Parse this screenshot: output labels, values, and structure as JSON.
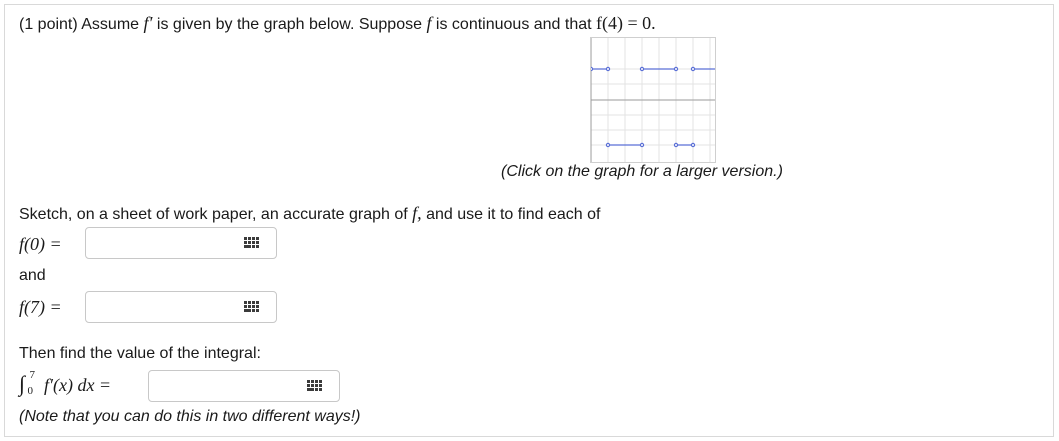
{
  "problem": {
    "intro_prefix": "(1 point) Assume",
    "intro_fprime": "f′",
    "intro_mid": "is given by the graph below. Suppose",
    "intro_f": "f",
    "intro_tail": "is continuous and that",
    "intro_condition": "f(4) = 0.",
    "graph_caption": "(Click on the graph for a larger version.)",
    "sketch_text_prefix": "Sketch, on a sheet of work paper, an accurate graph of",
    "sketch_text_f": "f,",
    "sketch_text_suffix": "and use it to find each of",
    "and_text": "and",
    "integral_intro": "Then find the value of the integral:",
    "note": "(Note that you can do this in two different ways!)"
  },
  "answers": [
    {
      "label": "f(0) =",
      "value": "",
      "placeholder": ""
    },
    {
      "label": "f(7) =",
      "value": "",
      "placeholder": ""
    },
    {
      "label_integral": "∫",
      "upper": "7",
      "lower": "0",
      "integrand": "f′(x) dx =",
      "value": "",
      "placeholder": ""
    }
  ],
  "icons": {
    "answer_tool_icon": "keypad-icon"
  },
  "colors": {
    "graph_line": "#5a6fd6",
    "grid": "#e3e3e3"
  }
}
